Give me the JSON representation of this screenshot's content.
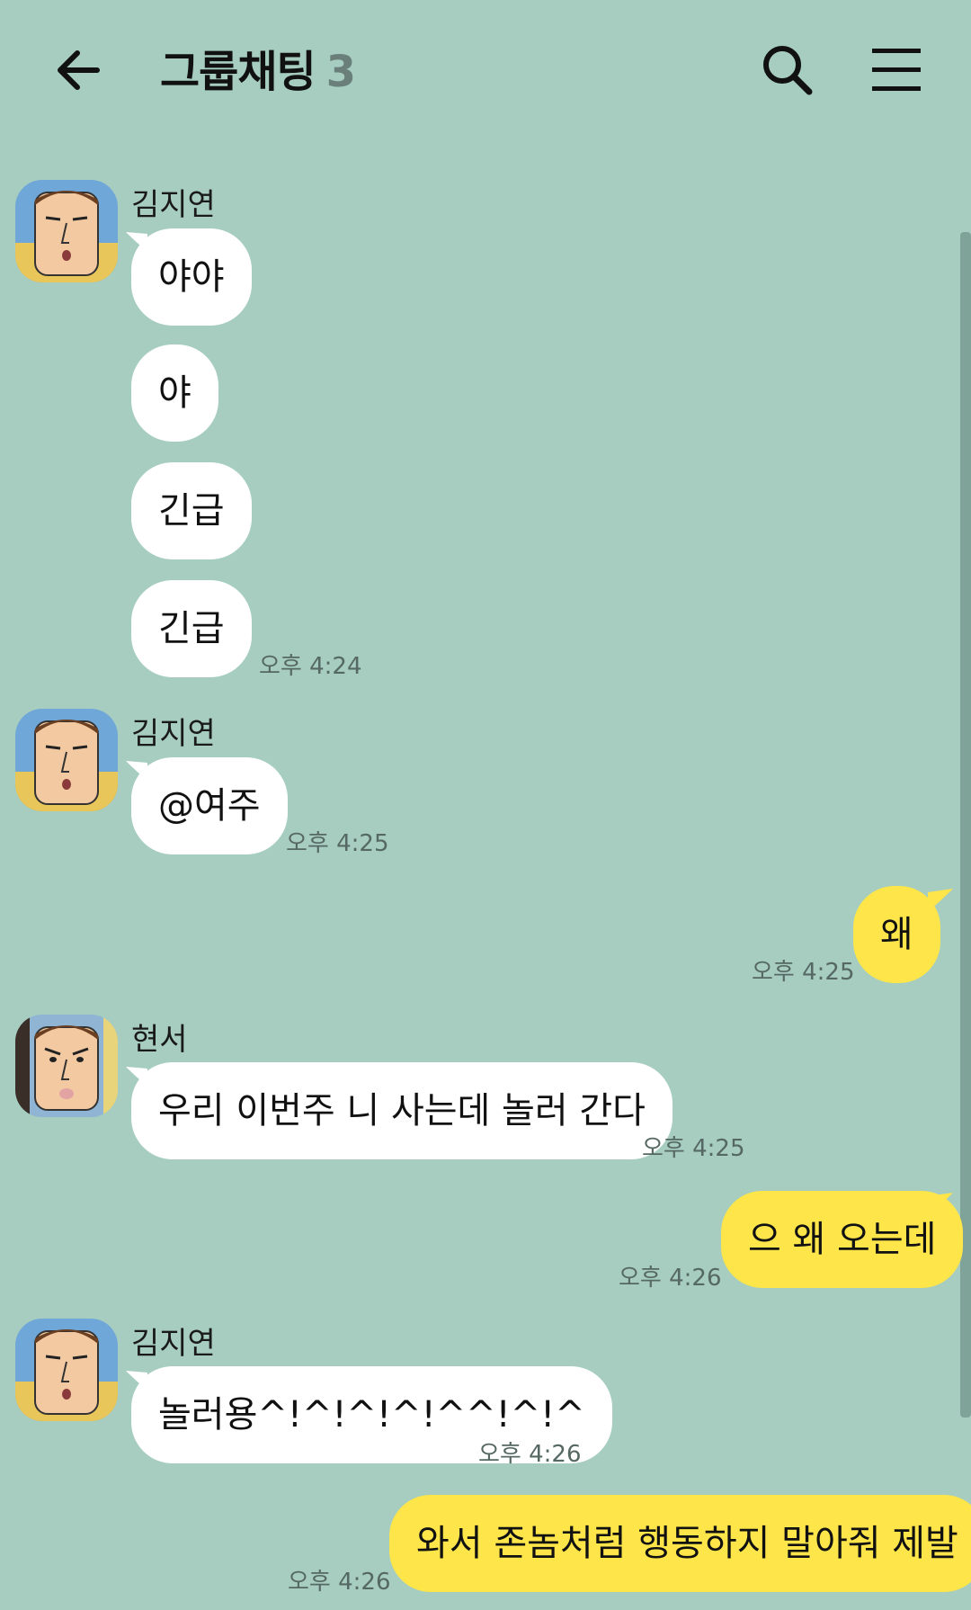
{
  "header": {
    "title": "그룹채팅",
    "member_count": "3"
  },
  "messages": [
    {
      "sender": "김지연",
      "text": "야야"
    },
    {
      "text": "야"
    },
    {
      "text": "긴급"
    },
    {
      "text": "긴급",
      "time": "오후 4:24"
    },
    {
      "sender": "김지연",
      "text": "@여주",
      "time": "오후 4:25"
    },
    {
      "text": "왜",
      "time": "오후 4:25",
      "mine": true
    },
    {
      "sender": "현서",
      "text": "우리 이번주 니 사는데 놀러 간다",
      "time": "오후 4:25"
    },
    {
      "text": "으 왜 오는데",
      "time": "오후 4:26",
      "mine": true
    },
    {
      "sender": "김지연",
      "text": "놀러용^!^!^!^!^^!^!^",
      "time": "오후 4:26"
    },
    {
      "text": "와서 존놈처럼 행동하지 말아줘 제발",
      "time": "오후 4:26",
      "mine": true
    }
  ],
  "colors": {
    "background": "#a6cdc0",
    "my_bubble": "#fde54a",
    "other_bubble": "#ffffff"
  },
  "icons": [
    "back-arrow-icon",
    "search-icon",
    "menu-icon"
  ]
}
